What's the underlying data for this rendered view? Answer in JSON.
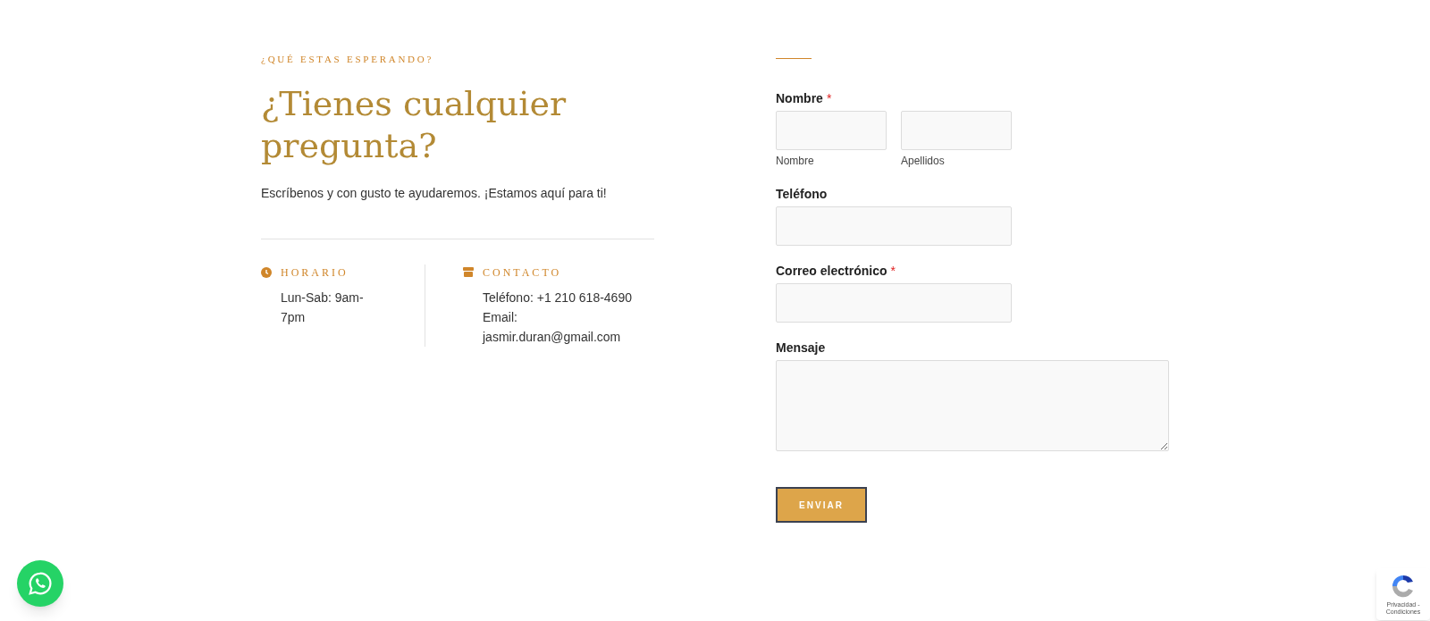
{
  "intro": {
    "eyebrow": "¿QUÉ ESTAS ESPERANDO?",
    "heading": "¿Tienes cualquier pregunta?",
    "text": "Escríbenos y con gusto te ayudaremos. ¡Estamos aquí para ti!"
  },
  "info": [
    {
      "kind": "clock",
      "title": "HORARIO",
      "lines": [
        "Lun-Sab: 9am-",
        "7pm"
      ]
    },
    {
      "kind": "store",
      "title": "CONTACTO",
      "lines": [
        "Teléfono: +1 210 618-4690",
        "Email:",
        "jasmir.duran@gmail.com"
      ]
    }
  ],
  "form": {
    "fields": [
      {
        "kind": "name",
        "label": "Nombre",
        "required_mark": "*",
        "sublabels": [
          "Nombre",
          "Apellidos"
        ]
      },
      {
        "kind": "text",
        "label": "Teléfono"
      },
      {
        "kind": "text",
        "label": "Correo electrónico",
        "required_mark": "*"
      },
      {
        "kind": "textarea",
        "label": "Mensaje"
      }
    ],
    "submit": "ENVIAR"
  },
  "recaptcha": {
    "text": "Privacidad - Condiciones"
  }
}
